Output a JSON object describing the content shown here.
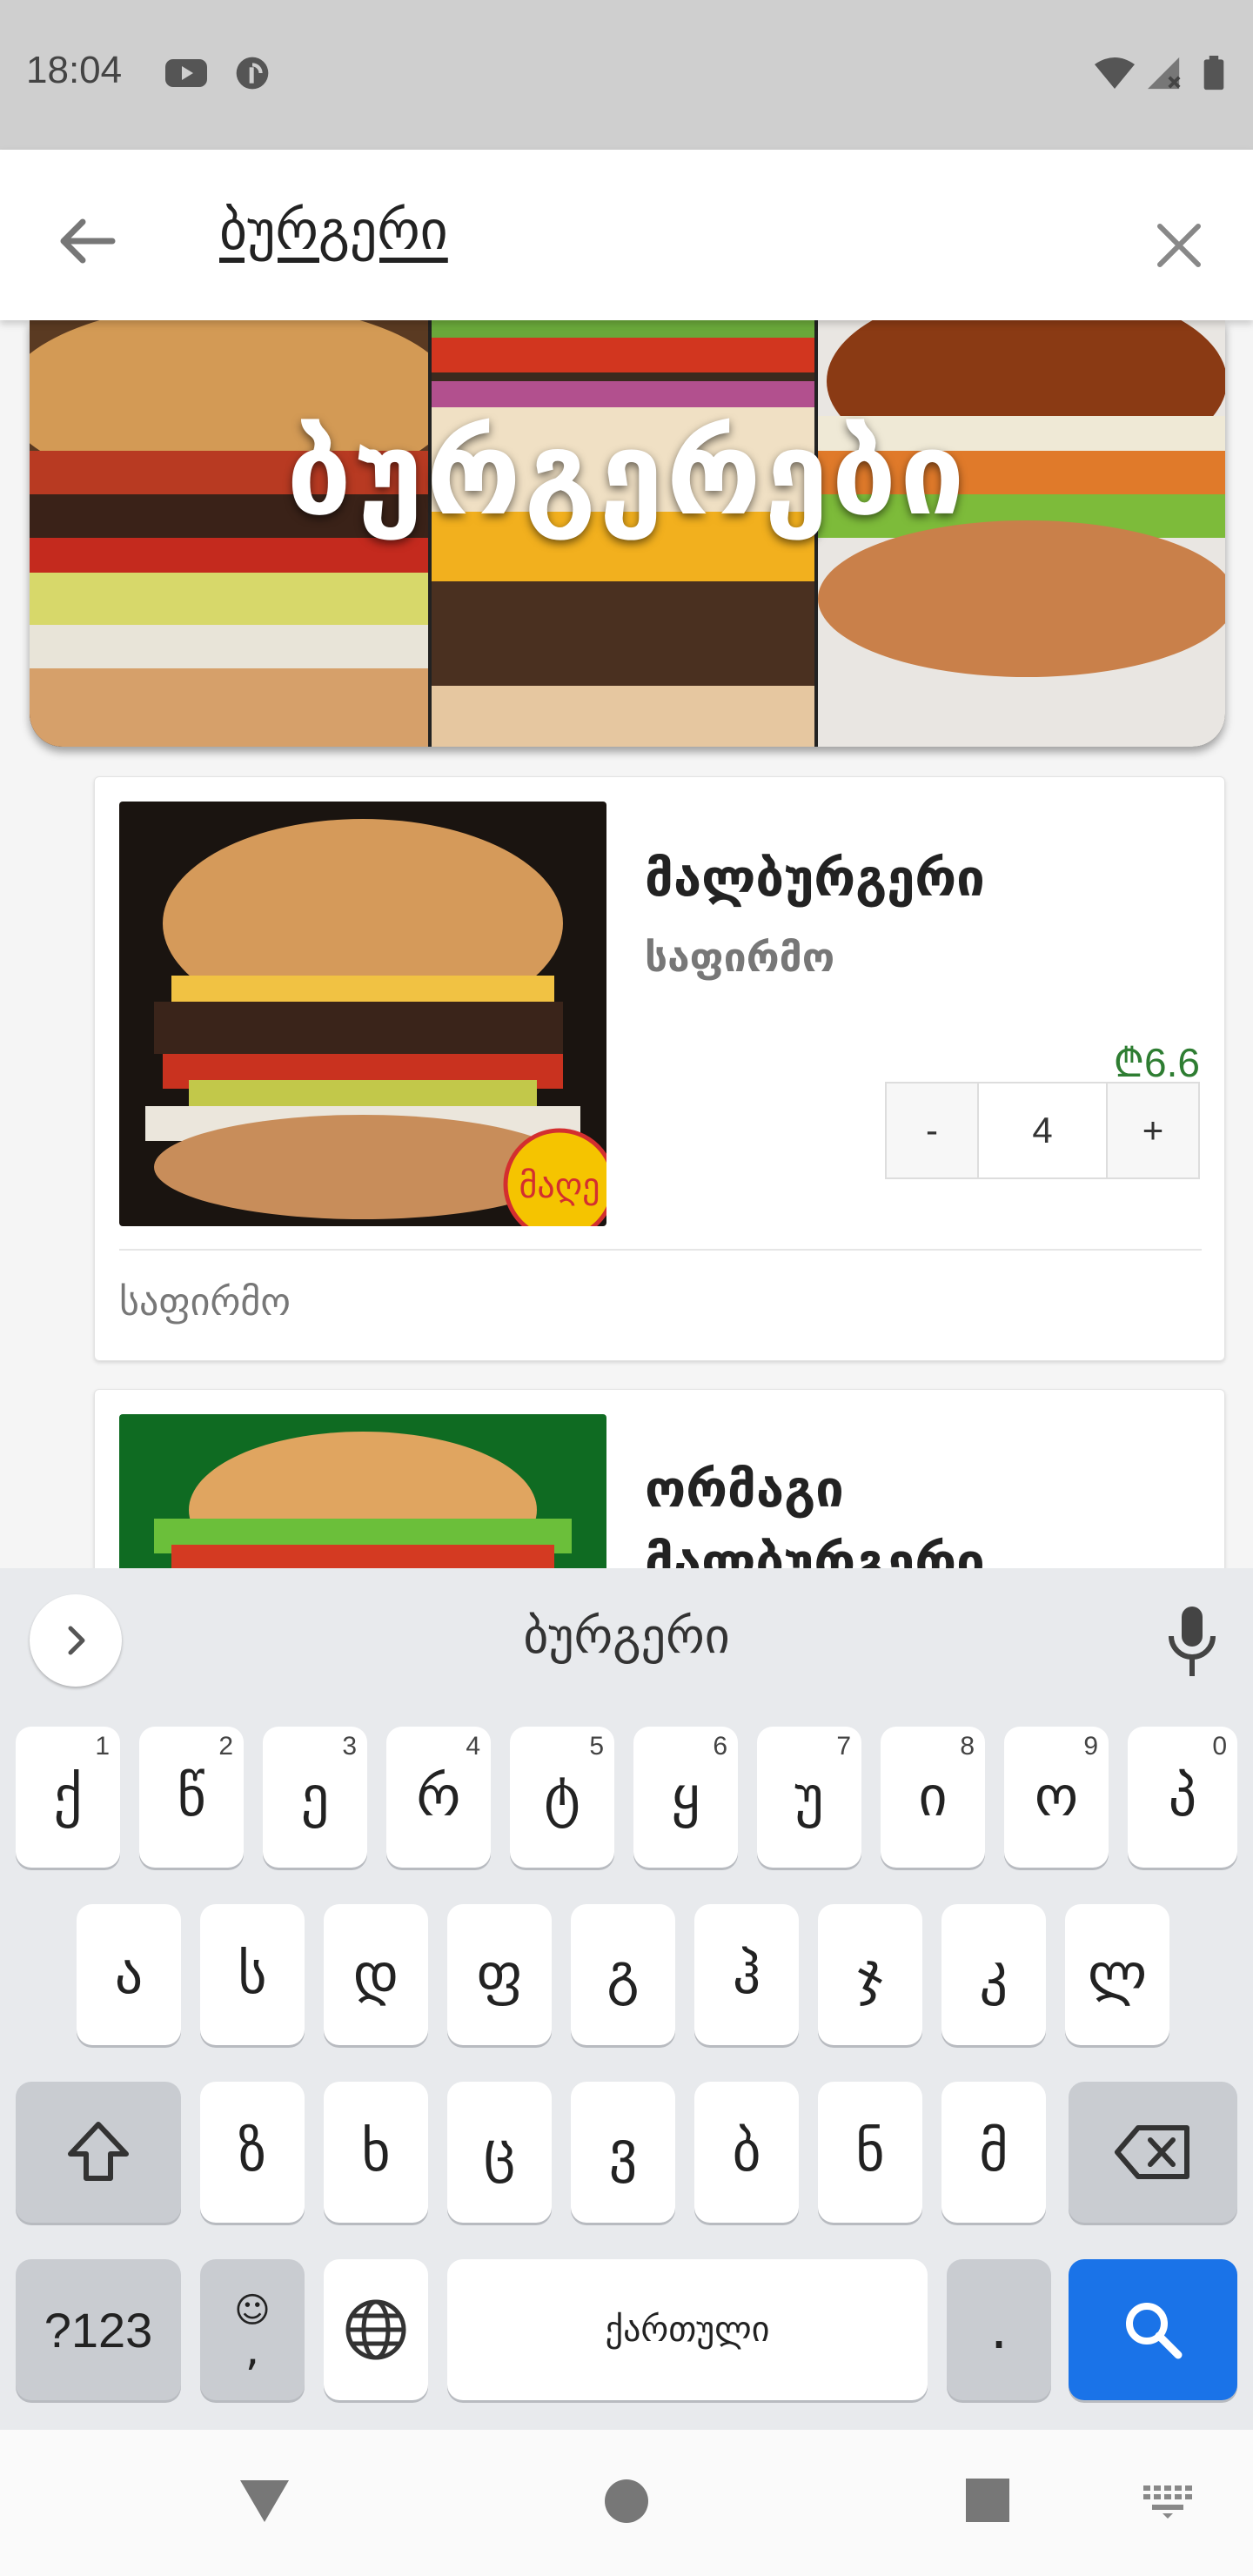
{
  "status_bar": {
    "time": "18:04",
    "icons": [
      "youtube-icon",
      "pocket-casts-icon",
      "wifi-icon",
      "signal-icon",
      "battery-icon"
    ]
  },
  "search": {
    "query": "ბურგერი",
    "back_icon": "arrow-left-icon",
    "clear_icon": "close-icon"
  },
  "banner": {
    "title": "ბურგერები"
  },
  "products": [
    {
      "name": "მალბურგერი",
      "brand": "საფირმო",
      "price": "₾6.6",
      "quantity": "4",
      "minus_label": "-",
      "plus_label": "+",
      "footer": "საფირმო",
      "badge": "მაღე"
    },
    {
      "name_line1": "ორმაგი",
      "name_line2": "მალბურგერი"
    }
  ],
  "keyboard": {
    "suggestion": "ბურგერი",
    "row1": [
      {
        "label": "ქ",
        "hint": "1"
      },
      {
        "label": "წ",
        "hint": "2"
      },
      {
        "label": "ე",
        "hint": "3"
      },
      {
        "label": "რ",
        "hint": "4"
      },
      {
        "label": "ტ",
        "hint": "5"
      },
      {
        "label": "ყ",
        "hint": "6"
      },
      {
        "label": "უ",
        "hint": "7"
      },
      {
        "label": "ი",
        "hint": "8"
      },
      {
        "label": "ო",
        "hint": "9"
      },
      {
        "label": "პ",
        "hint": "0"
      }
    ],
    "row2": [
      "ა",
      "ს",
      "დ",
      "ფ",
      "გ",
      "ჰ",
      "ჯ",
      "კ",
      "ლ"
    ],
    "row3": [
      "ზ",
      "ხ",
      "ც",
      "ვ",
      "ბ",
      "ნ",
      "მ"
    ],
    "symbols_label": "?123",
    "emoji_label": "☺",
    "comma_label": ",",
    "space_label": "ქართული",
    "period_label": ".",
    "accent_color": "#1a73e8"
  },
  "nav_bar": {
    "icons": [
      "back-triangle-icon",
      "home-circle-icon",
      "recents-square-icon",
      "keyboard-switch-icon"
    ]
  }
}
